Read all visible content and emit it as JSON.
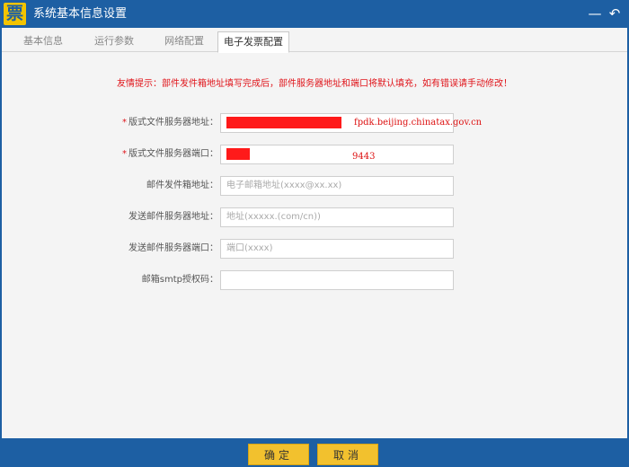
{
  "window": {
    "logo_char": "票",
    "title": "系统基本信息设置",
    "minimize_glyph": "—",
    "back_glyph": "↶"
  },
  "tabs": [
    {
      "label": "基本信息",
      "active": false
    },
    {
      "label": "运行参数",
      "active": false
    },
    {
      "label": "网络配置",
      "active": false
    },
    {
      "label": "电子发票配置",
      "active": true
    }
  ],
  "tip": "友情提示：部件发件箱地址填写完成后，部件服务器地址和端口将默认填充，如有错误请手动修改！",
  "form": {
    "required_mark": "*",
    "layout_server": {
      "label": "版式文件服务器地址：",
      "value": "fpdk.beijing.chinatax.gov.cn",
      "required": true
    },
    "layout_port": {
      "label": "版式文件服务器端口：",
      "value": "9443",
      "required": true
    },
    "mail_sender": {
      "label": "邮件发件箱地址：",
      "placeholder": "电子邮箱地址(xxxx@xx.xx)",
      "value": ""
    },
    "smtp_server": {
      "label": "发送邮件服务器地址：",
      "placeholder": "地址(xxxxx.(com/cn))",
      "value": ""
    },
    "smtp_port": {
      "label": "发送邮件服务器端口：",
      "placeholder": "端口(xxxx)",
      "value": ""
    },
    "smtp_auth": {
      "label": "邮箱smtp授权码：",
      "placeholder": "",
      "value": ""
    }
  },
  "buttons": {
    "ok": "确定",
    "cancel": "取消"
  },
  "colors": {
    "frame_blue": "#1d5fa3",
    "button_yellow": "#f2c12e",
    "tip_red": "#e0141a"
  }
}
